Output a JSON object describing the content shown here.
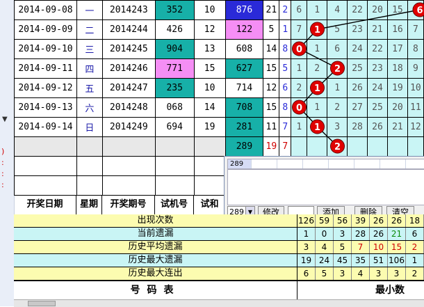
{
  "draw_rows": [
    {
      "date": "2014-09-08",
      "weekday": "一",
      "period": "2014243",
      "n1": "352",
      "n1_style": "teal",
      "n2": "10",
      "n3": "876",
      "n3_style": "blue",
      "n4": "21",
      "n5": "2",
      "trend": [
        "6",
        "1",
        "4",
        "22",
        "20",
        "15",
        "6"
      ],
      "ball": 6
    },
    {
      "date": "2014-09-09",
      "weekday": "二",
      "period": "2014244",
      "n1": "426",
      "n1_style": "",
      "n2": "12",
      "n3": "122",
      "n3_style": "pink",
      "n4": "5",
      "n5": "1",
      "trend": [
        "7",
        "1",
        "5",
        "23",
        "21",
        "16",
        "7"
      ],
      "ball": 1
    },
    {
      "date": "2014-09-10",
      "weekday": "三",
      "period": "2014245",
      "n1": "904",
      "n1_style": "teal",
      "n2": "13",
      "n3": "608",
      "n3_style": "",
      "n4": "14",
      "n5": "8",
      "trend": [
        "0",
        "1",
        "6",
        "24",
        "22",
        "17",
        "8"
      ],
      "ball": 0
    },
    {
      "date": "2014-09-11",
      "weekday": "四",
      "period": "2014246",
      "n1": "771",
      "n1_style": "pink",
      "n2": "15",
      "n3": "627",
      "n3_style": "teal",
      "n4": "15",
      "n5": "5",
      "trend": [
        "1",
        "2",
        "2",
        "25",
        "23",
        "18",
        "9"
      ],
      "ball": 2
    },
    {
      "date": "2014-09-12",
      "weekday": "五",
      "period": "2014247",
      "n1": "235",
      "n1_style": "teal",
      "n2": "10",
      "n3": "714",
      "n3_style": "",
      "n4": "12",
      "n5": "6",
      "trend": [
        "2",
        "1",
        "1",
        "26",
        "24",
        "19",
        "10"
      ],
      "ball": 1
    },
    {
      "date": "2014-09-13",
      "weekday": "六",
      "period": "2014248",
      "n1": "068",
      "n1_style": "",
      "n2": "14",
      "n3": "708",
      "n3_style": "teal",
      "n4": "15",
      "n5": "8",
      "trend": [
        "0",
        "1",
        "2",
        "27",
        "25",
        "20",
        "11"
      ],
      "ball": 0
    },
    {
      "date": "2014-09-14",
      "weekday": "日",
      "period": "2014249",
      "n1": "694",
      "n1_style": "",
      "n2": "19",
      "n3": "281",
      "n3_style": "teal",
      "n4": "11",
      "n5": "7",
      "trend": [
        "1",
        "1",
        "3",
        "28",
        "26",
        "21",
        "12"
      ],
      "ball": 1
    }
  ],
  "prediction_row": {
    "n3": "289",
    "n4": "19",
    "n5": "7",
    "ball": "2"
  },
  "header": [
    "开奖日期",
    "星期",
    "开奖期号",
    "试机号",
    "试和"
  ],
  "dialog": {
    "strip_first": "289",
    "combo_value": "289",
    "modify_label": "修改",
    "add_label": "添加",
    "delete_label": "删除",
    "clear_label": "清空"
  },
  "stats": [
    {
      "label": "出现次数",
      "style": "yellow",
      "values": [
        "126",
        "59",
        "56",
        "39",
        "26",
        "26",
        "18"
      ]
    },
    {
      "label": "当前遗漏",
      "style": "cyan",
      "values": [
        "1",
        "0",
        "3",
        "28",
        "26",
        "21",
        "6"
      ]
    },
    {
      "label": "历史平均遗漏",
      "style": "yellow",
      "values": [
        "3",
        "4",
        "5",
        "7",
        "10",
        "15",
        "2"
      ]
    },
    {
      "label": "历史最大遗漏",
      "style": "cyan",
      "values": [
        "19",
        "24",
        "45",
        "35",
        "51",
        "106",
        "1"
      ]
    },
    {
      "label": "历史最大连出",
      "style": "yellow",
      "values": [
        "6",
        "5",
        "3",
        "4",
        "3",
        "3",
        "2"
      ]
    }
  ],
  "footer": {
    "left": "号码表",
    "right": "最小数"
  },
  "colors": {
    "teal": "#17b0a8",
    "pink": "#f58ef5",
    "blue": "#2a2ad8",
    "yellow": "#fcfcb0",
    "cyan": "#c9f5f5",
    "ball": "#e00000"
  }
}
